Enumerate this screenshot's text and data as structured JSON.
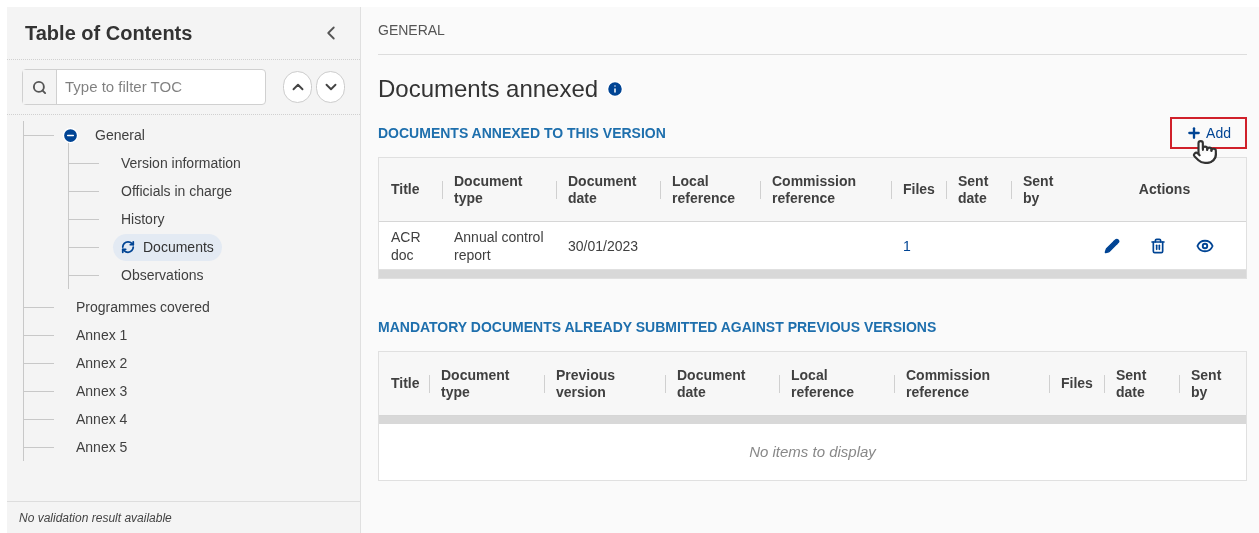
{
  "sidebar": {
    "title": "Table of Contents",
    "filter": {
      "placeholder": "Type to filter TOC"
    },
    "items": [
      {
        "label": "General",
        "expanded": true,
        "selected": false,
        "children": [
          {
            "label": "Version information",
            "selected": false
          },
          {
            "label": "Officials in charge",
            "selected": false
          },
          {
            "label": "History",
            "selected": false
          },
          {
            "label": "Documents",
            "selected": true
          },
          {
            "label": "Observations",
            "selected": false
          }
        ]
      },
      {
        "label": "Programmes covered",
        "selected": false
      },
      {
        "label": "Annex 1",
        "selected": false
      },
      {
        "label": "Annex 2",
        "selected": false
      },
      {
        "label": "Annex 3",
        "selected": false
      },
      {
        "label": "Annex 4",
        "selected": false
      },
      {
        "label": "Annex 5",
        "selected": false
      }
    ],
    "status": "No validation result available"
  },
  "breadcrumb": "GENERAL",
  "heading": "Documents annexed",
  "sections": [
    {
      "title": "DOCUMENTS ANNEXED TO THIS VERSION",
      "add_button": "Add",
      "columns": [
        "Title",
        "Document type",
        "Document date",
        "Local reference",
        "Commission reference",
        "Files",
        "Sent date",
        "Sent by",
        "Actions"
      ],
      "rows": [
        {
          "cells": [
            "ACR doc",
            "Annual control report",
            "30/01/2023",
            "",
            "",
            "1",
            "",
            ""
          ]
        }
      ]
    },
    {
      "title": "MANDATORY DOCUMENTS ALREADY SUBMITTED AGAINST PREVIOUS VERSIONS",
      "columns": [
        "Title",
        "Document type",
        "Previous version",
        "Document date",
        "Local reference",
        "Commission reference",
        "Files",
        "Sent date",
        "Sent by"
      ],
      "empty_text": "No items to display"
    }
  ]
}
